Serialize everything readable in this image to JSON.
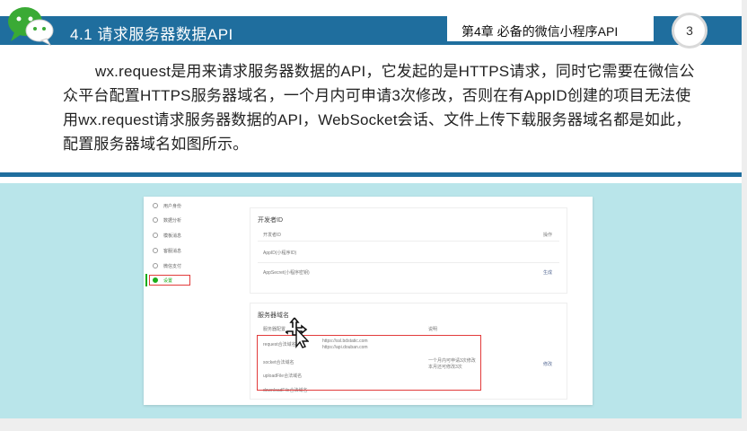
{
  "header": {
    "title": "4.1 请求服务器数据API",
    "chapter": "第4章   必备的微信小程序API",
    "page_number": "3"
  },
  "body_text": "wx.request是用来请求服务器数据的API，它发起的是HTTPS请求，同时它需要在微信公众平台配置HTTPS服务器域名，一个月内可申请3次修改，否则在有AppID创建的项目无法使用wx.request请求服务器数据的API，WebSocket会话、文件上传下载服务器域名都是如此，配置服务器域名如图所示。",
  "screenshot": {
    "sidebar": [
      {
        "label": "用户身份",
        "active": false
      },
      {
        "label": "数据分析",
        "active": false
      },
      {
        "label": "模板消息",
        "active": false
      },
      {
        "label": "客服消息",
        "active": false
      },
      {
        "label": "微信支付",
        "active": false
      },
      {
        "label": "设置",
        "active": true
      }
    ],
    "dev_card": {
      "title": "开发者ID",
      "header_left": "开发者ID",
      "header_right": "操作",
      "row1": "AppID(小程序ID)",
      "row2": "AppSecret(小程序密钥)",
      "row2_action": "生成"
    },
    "server_card": {
      "title": "服务器域名",
      "header_left": "服务器配置",
      "header_mid": "说明",
      "rows": [
        "request合法域名",
        "socket合法域名",
        "uploadFile合法域名",
        "downloadFile合法域名"
      ],
      "domain1": "https://ssl.bdstatic.com",
      "domain2": "https://api.douban.com",
      "note1": "一个月内可申请3次修改",
      "note2": "本月还可修改3次",
      "action": "修改"
    }
  }
}
